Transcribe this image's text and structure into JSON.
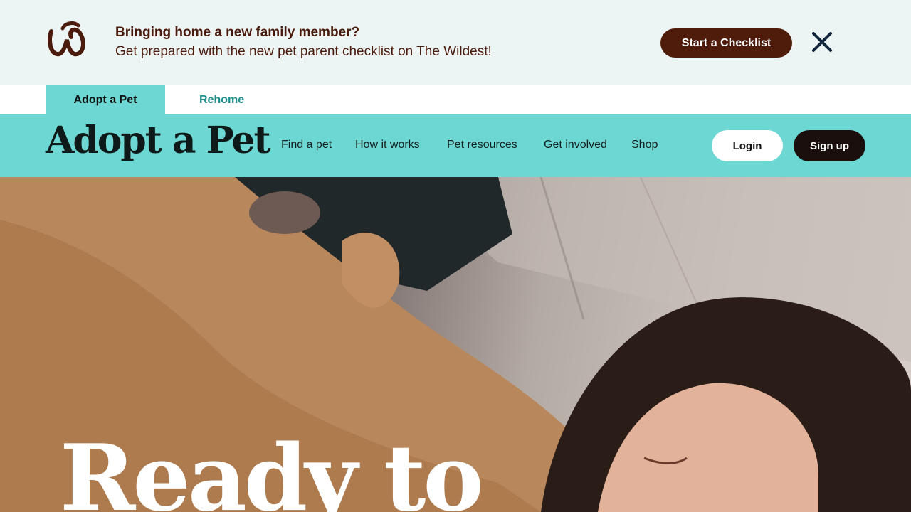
{
  "promo": {
    "title": "Bringing home a new family member?",
    "subtitle": "Get prepared with the new pet parent checklist on The Wildest!",
    "cta_label": "Start a Checklist",
    "logo_icon": "the-wildest-logo-icon",
    "close_icon": "close-icon",
    "brand_color": "#4f1c0b"
  },
  "site_tabs": {
    "adopt": "Adopt a Pet",
    "rehome": "Rehome"
  },
  "header": {
    "logo_text": "Adopt a Pet",
    "nav": {
      "find": "Find a pet",
      "how": "How it works",
      "resources": "Pet resources",
      "involved": "Get involved",
      "shop": "Shop"
    },
    "login_label": "Login",
    "signup_label": "Sign up",
    "accent_color": "#6dd8d3"
  },
  "hero": {
    "heading": "Ready to"
  }
}
